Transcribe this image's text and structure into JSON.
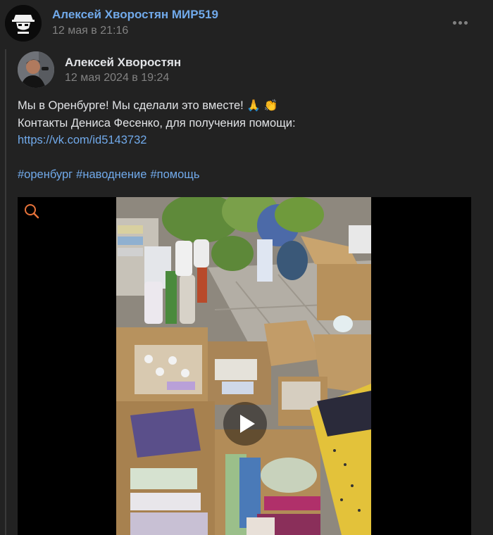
{
  "header": {
    "owner_name": "Алексей Хворостян МИР519",
    "date": "12 мая в 21:16",
    "more_icon": "more-horizontal-icon"
  },
  "repost": {
    "author_name": "Алексей Хворостян",
    "date": "12 мая 2024 в 19:24",
    "text_line1": "Мы в Оренбурге! Мы сделали это вместе! ",
    "emoji1": "🙏",
    "emoji2": "👏",
    "text_line2": "Контакты Дениса Фесенко, для получения помощи:",
    "link": "https://vk.com/id5143732",
    "hashtags": [
      "#оренбург",
      "#наводнение",
      "#помощь"
    ]
  },
  "video": {
    "search_icon": "search-icon",
    "play_icon": "play-icon",
    "accent_color": "#e8733a"
  },
  "colors": {
    "background": "#222222",
    "link": "#71aaeb",
    "text": "#e1e3e6",
    "secondary": "#828282"
  }
}
